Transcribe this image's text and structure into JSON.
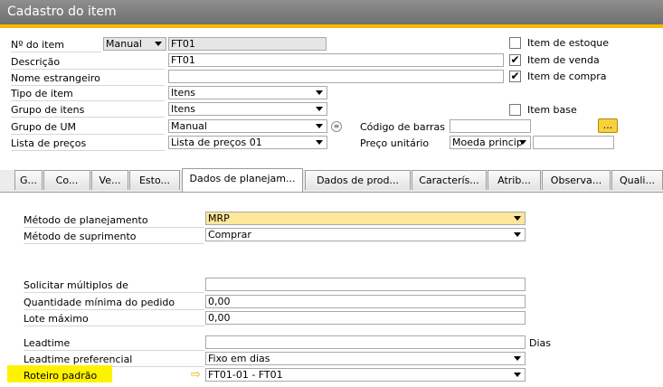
{
  "window": {
    "title": "Cadastro do item"
  },
  "form": {
    "item_no_label": "Nº do item",
    "numbering_mode": "Manual",
    "item_no_value": "FT01",
    "description_label": "Descrição",
    "description_value": "FT01",
    "foreign_name_label": "Nome estrangeiro",
    "foreign_name_value": "",
    "item_type_label": "Tipo de item",
    "item_type_value": "Itens",
    "item_group_label": "Grupo de itens",
    "item_group_value": "Itens",
    "uom_group_label": "Grupo de UM",
    "uom_group_value": "Manual",
    "price_list_label": "Lista de preços",
    "price_list_value": "Lista de preços 01",
    "barcode_label": "Código de barras",
    "barcode_value": "",
    "barcode_button": "...",
    "unit_price_label": "Preço unitário",
    "currency_value": "Moeda princip",
    "unit_price_value": "",
    "inventory_item_label": "Item de estoque",
    "inventory_item_checked": "",
    "sales_item_label": "Item de venda",
    "sales_item_checked": "✔",
    "purchase_item_label": "Item de compra",
    "purchase_item_checked": "✔",
    "base_item_label": "Item base",
    "base_item_checked": ""
  },
  "tabs": [
    {
      "label": "G..."
    },
    {
      "label": "Co..."
    },
    {
      "label": "Ve..."
    },
    {
      "label": "Esto..."
    },
    {
      "label": "Dados de planejam..."
    },
    {
      "label": "Dados de prod..."
    },
    {
      "label": "Caracterís..."
    },
    {
      "label": "Atrib..."
    },
    {
      "label": "Observa..."
    },
    {
      "label": "Quali..."
    }
  ],
  "planning": {
    "planning_method_label": "Método de planejamento",
    "planning_method_value": "MRP",
    "procurement_method_label": "Método de suprimento",
    "procurement_method_value": "Comprar",
    "order_multiple_label": "Solicitar múltiplos de",
    "order_multiple_value": "",
    "min_order_qty_label": "Quantidade mínima do pedido",
    "min_order_qty_value": "0,00",
    "max_lot_label": "Lote máximo",
    "max_lot_value": "0,00",
    "leadtime_label": "Leadtime",
    "leadtime_value": "",
    "leadtime_unit": "Dias",
    "pref_leadtime_label": "Leadtime preferencial",
    "pref_leadtime_value": "Fixo em dias",
    "default_routing_label": "Roteiro padrão",
    "default_routing_value": "FT01-01 - FT01"
  },
  "colors": {
    "accent": "#f5b800",
    "highlight": "#fff200",
    "field_highlight": "#fde79a"
  }
}
